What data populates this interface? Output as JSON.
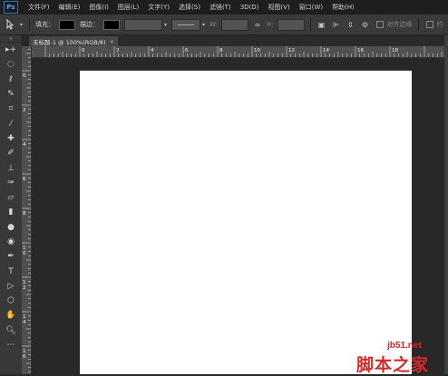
{
  "app": {
    "logo": "Ps"
  },
  "menu": [
    "文件(F)",
    "编辑(E)",
    "图像(I)",
    "图层(L)",
    "文字(Y)",
    "选择(S)",
    "滤镜(T)",
    "3D(D)",
    "视图(V)",
    "窗口(W)",
    "帮助(H)"
  ],
  "options": {
    "tool_icon": "path-selection-icon",
    "fill_label": "填充：",
    "stroke_label": "描边：",
    "w_label": "W:",
    "h_label": "H:",
    "align_edges_label": "对齐边缘",
    "cut_label": "约"
  },
  "tab": {
    "title": "未标题-1 @ 100%(RGB/8)",
    "close": "×"
  },
  "rulers": {
    "top": [
      "0",
      "2",
      "4",
      "6",
      "8",
      "10",
      "12",
      "14",
      "16",
      "18"
    ],
    "left": [
      "0",
      "2",
      "4",
      "6",
      "8",
      "1\n0",
      "1\n2",
      "1\n4",
      "1\n6",
      "1\n8"
    ]
  },
  "tools": [
    {
      "name": "move-tool-icon",
      "glyph": "▸+"
    },
    {
      "name": "marquee-tool-icon",
      "glyph": "◌"
    },
    {
      "name": "lasso-tool-icon",
      "glyph": "ℓ"
    },
    {
      "name": "quick-selection-tool-icon",
      "glyph": "✎"
    },
    {
      "name": "crop-tool-icon",
      "glyph": "⌗"
    },
    {
      "name": "eyedropper-tool-icon",
      "glyph": "⁄"
    },
    {
      "name": "healing-brush-tool-icon",
      "glyph": "✚"
    },
    {
      "name": "brush-tool-icon",
      "glyph": "✐"
    },
    {
      "name": "clone-stamp-tool-icon",
      "glyph": "⊥"
    },
    {
      "name": "history-brush-tool-icon",
      "glyph": "✑"
    },
    {
      "name": "eraser-tool-icon",
      "glyph": "▱"
    },
    {
      "name": "gradient-tool-icon",
      "glyph": "▮"
    },
    {
      "name": "blur-tool-icon",
      "glyph": "●"
    },
    {
      "name": "dodge-tool-icon",
      "glyph": "◉"
    },
    {
      "name": "pen-tool-icon",
      "glyph": "✒"
    },
    {
      "name": "type-tool-icon",
      "glyph": "T"
    },
    {
      "name": "path-selection-tool-icon",
      "glyph": "▷"
    },
    {
      "name": "shape-tool-icon",
      "glyph": "⬡"
    },
    {
      "name": "hand-tool-icon",
      "glyph": "✋"
    },
    {
      "name": "zoom-tool-icon",
      "glyph": "🔍︎"
    },
    {
      "name": "more-tools-icon",
      "glyph": "⋯"
    }
  ],
  "watermark": {
    "site": "jb51.net",
    "brand": "脚本之家"
  },
  "colors": {
    "fill": "#000000",
    "stroke": "#000000",
    "canvas": "#ffffff",
    "accent": "#2f77b5"
  }
}
